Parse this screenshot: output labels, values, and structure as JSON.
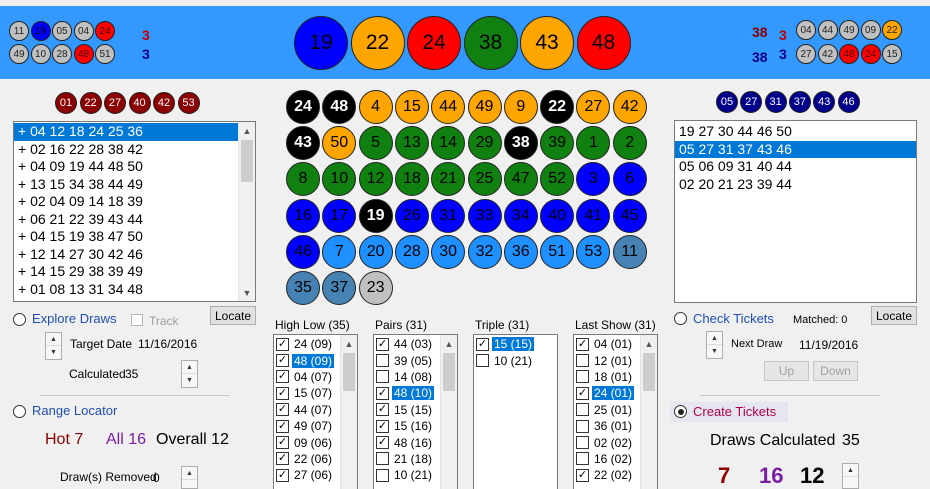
{
  "colors": {
    "header_bg": "#3399ff",
    "black": "#000000",
    "orange": "#ffa500",
    "red": "#ff0000",
    "green": "#108010",
    "blue": "#0000ff",
    "light_blue": "#1e90ff",
    "steel": "#4682b4",
    "grey": "#c0c0c0",
    "maroon": "#8b0000",
    "navy": "#00008b",
    "selection": "#0078d7"
  },
  "header": {
    "main_draw": [
      {
        "n": "19",
        "c": "blue"
      },
      {
        "n": "22",
        "c": "orange"
      },
      {
        "n": "24",
        "c": "red"
      },
      {
        "n": "38",
        "c": "green"
      },
      {
        "n": "43",
        "c": "orange"
      },
      {
        "n": "48",
        "c": "red"
      }
    ],
    "left_top": [
      {
        "n": "11",
        "c": "grey"
      },
      {
        "n": "19",
        "c": "blue"
      },
      {
        "n": "05",
        "c": "grey"
      },
      {
        "n": "04",
        "c": "grey"
      },
      {
        "n": "24",
        "c": "red"
      }
    ],
    "left_top_count": "3",
    "left_bottom": [
      {
        "n": "49",
        "c": "grey"
      },
      {
        "n": "10",
        "c": "grey"
      },
      {
        "n": "28",
        "c": "grey"
      },
      {
        "n": "48",
        "c": "red"
      },
      {
        "n": "51",
        "c": "grey"
      }
    ],
    "left_bottom_count": "3",
    "right_top_num": "38",
    "right_top_count": "3",
    "right_top": [
      {
        "n": "04",
        "c": "grey"
      },
      {
        "n": "44",
        "c": "grey"
      },
      {
        "n": "49",
        "c": "grey"
      },
      {
        "n": "09",
        "c": "grey"
      },
      {
        "n": "22",
        "c": "orange"
      }
    ],
    "right_bottom_num": "38",
    "right_bottom_count": "3",
    "right_bottom": [
      {
        "n": "27",
        "c": "grey"
      },
      {
        "n": "42",
        "c": "grey"
      },
      {
        "n": "48",
        "c": "red"
      },
      {
        "n": "24",
        "c": "red"
      },
      {
        "n": "15",
        "c": "grey"
      }
    ]
  },
  "left_panel": {
    "top_balls": [
      "01",
      "22",
      "27",
      "40",
      "42",
      "53"
    ],
    "draws": [
      "+ 04 12 18 24 25 36",
      "+ 02 16 22 28 38 42",
      "+ 04 09 19 44 48 50",
      "+ 13 15 34 38 44 49",
      "+ 02 04 09 14 18 39",
      "+ 06 21 22 39 43 44",
      "+ 04 15 19 38 47 50",
      "+ 12 14 27 30 42 46",
      "+ 14 15 29 38 39 49",
      "+ 01 08 13 31 34 48"
    ],
    "explore_label": "Explore Draws",
    "track_label": "Track",
    "locate_label": "Locate",
    "target_date_label": "Target Date",
    "target_date": "11/16/2016",
    "calculated_label": "Calculated",
    "calculated_value": "35",
    "range_label": "Range Locator",
    "hot_label": "Hot 7",
    "all_label": "All 16",
    "overall_label": "Overall 12",
    "draws_removed_label": "Draw(s) Removed",
    "draws_removed_value": "0"
  },
  "grid_balls": [
    {
      "n": "24",
      "c": "black"
    },
    {
      "n": "48",
      "c": "black"
    },
    {
      "n": "4",
      "c": "orange"
    },
    {
      "n": "15",
      "c": "orange"
    },
    {
      "n": "44",
      "c": "orange"
    },
    {
      "n": "49",
      "c": "orange"
    },
    {
      "n": "9",
      "c": "orange"
    },
    {
      "n": "22",
      "c": "black"
    },
    {
      "n": "27",
      "c": "orange"
    },
    {
      "n": "42",
      "c": "orange"
    },
    {
      "n": "43",
      "c": "black"
    },
    {
      "n": "50",
      "c": "orange"
    },
    {
      "n": "5",
      "c": "green"
    },
    {
      "n": "13",
      "c": "green"
    },
    {
      "n": "14",
      "c": "green"
    },
    {
      "n": "29",
      "c": "green"
    },
    {
      "n": "38",
      "c": "black"
    },
    {
      "n": "39",
      "c": "green"
    },
    {
      "n": "1",
      "c": "green"
    },
    {
      "n": "2",
      "c": "green"
    },
    {
      "n": "8",
      "c": "green"
    },
    {
      "n": "10",
      "c": "green"
    },
    {
      "n": "12",
      "c": "green"
    },
    {
      "n": "18",
      "c": "green"
    },
    {
      "n": "21",
      "c": "green"
    },
    {
      "n": "25",
      "c": "green"
    },
    {
      "n": "47",
      "c": "green"
    },
    {
      "n": "52",
      "c": "green"
    },
    {
      "n": "3",
      "c": "blue"
    },
    {
      "n": "6",
      "c": "blue"
    },
    {
      "n": "16",
      "c": "blue"
    },
    {
      "n": "17",
      "c": "blue"
    },
    {
      "n": "19",
      "c": "black"
    },
    {
      "n": "26",
      "c": "blue"
    },
    {
      "n": "31",
      "c": "blue"
    },
    {
      "n": "33",
      "c": "blue"
    },
    {
      "n": "34",
      "c": "blue"
    },
    {
      "n": "40",
      "c": "blue"
    },
    {
      "n": "41",
      "c": "blue"
    },
    {
      "n": "45",
      "c": "blue"
    },
    {
      "n": "46",
      "c": "blue"
    },
    {
      "n": "7",
      "c": "light_blue"
    },
    {
      "n": "20",
      "c": "light_blue"
    },
    {
      "n": "28",
      "c": "light_blue"
    },
    {
      "n": "30",
      "c": "light_blue"
    },
    {
      "n": "32",
      "c": "light_blue"
    },
    {
      "n": "36",
      "c": "light_blue"
    },
    {
      "n": "51",
      "c": "light_blue"
    },
    {
      "n": "53",
      "c": "light_blue"
    },
    {
      "n": "11",
      "c": "steel"
    },
    {
      "n": "35",
      "c": "steel"
    },
    {
      "n": "37",
      "c": "steel"
    },
    {
      "n": "23",
      "c": "grey"
    }
  ],
  "lists": [
    {
      "title": "High Low (35)",
      "items": [
        {
          "t": "24 (09)",
          "c": true,
          "s": false
        },
        {
          "t": "48 (09)",
          "c": true,
          "s": true
        },
        {
          "t": "04 (07)",
          "c": true,
          "s": false
        },
        {
          "t": "15 (07)",
          "c": true,
          "s": false
        },
        {
          "t": "44 (07)",
          "c": true,
          "s": false
        },
        {
          "t": "49 (07)",
          "c": true,
          "s": false
        },
        {
          "t": "09 (06)",
          "c": true,
          "s": false
        },
        {
          "t": "22 (06)",
          "c": true,
          "s": false
        },
        {
          "t": "27 (06)",
          "c": true,
          "s": false
        }
      ]
    },
    {
      "title": "Pairs (31)",
      "items": [
        {
          "t": "44 (03)",
          "c": true,
          "s": false
        },
        {
          "t": "39 (05)",
          "c": false,
          "s": false
        },
        {
          "t": "14 (08)",
          "c": false,
          "s": false
        },
        {
          "t": "48 (10)",
          "c": true,
          "s": true
        },
        {
          "t": "15 (15)",
          "c": true,
          "s": false
        },
        {
          "t": "15 (16)",
          "c": true,
          "s": false
        },
        {
          "t": "48 (16)",
          "c": true,
          "s": false
        },
        {
          "t": "21 (18)",
          "c": false,
          "s": false
        },
        {
          "t": "10 (21)",
          "c": false,
          "s": false
        }
      ]
    },
    {
      "title": "Triple (31)",
      "items": [
        {
          "t": "15 (15)",
          "c": true,
          "s": true
        },
        {
          "t": "10 (21)",
          "c": false,
          "s": false
        }
      ]
    },
    {
      "title": "Last Show (31)",
      "items": [
        {
          "t": "04 (01)",
          "c": true,
          "s": false
        },
        {
          "t": "12 (01)",
          "c": false,
          "s": false
        },
        {
          "t": "18 (01)",
          "c": false,
          "s": false
        },
        {
          "t": "24 (01)",
          "c": true,
          "s": true
        },
        {
          "t": "25 (01)",
          "c": false,
          "s": false
        },
        {
          "t": "36 (01)",
          "c": false,
          "s": false
        },
        {
          "t": "02 (02)",
          "c": false,
          "s": false
        },
        {
          "t": "16 (02)",
          "c": false,
          "s": false
        },
        {
          "t": "22 (02)",
          "c": true,
          "s": false
        }
      ]
    }
  ],
  "right_panel": {
    "top_balls": [
      "05",
      "27",
      "31",
      "37",
      "43",
      "46"
    ],
    "tickets": [
      "19 27 30 44 46 50",
      "05 27 31 37 43 46",
      "05 06 09 31 40 44",
      "02 20 21 23 39 44"
    ],
    "selected_ticket": 1,
    "locate_label": "Locate",
    "check_label": "Check Tickets",
    "matched_label": "Matched: 0",
    "next_draw_label": "Next Draw",
    "next_draw_date": "11/19/2016",
    "up_label": "Up",
    "down_label": "Down",
    "create_label": "Create Tickets",
    "draws_calc_label": "Draws Calculated",
    "draws_calc_value": "35",
    "n1": "7",
    "n2": "16",
    "n3": "12"
  }
}
